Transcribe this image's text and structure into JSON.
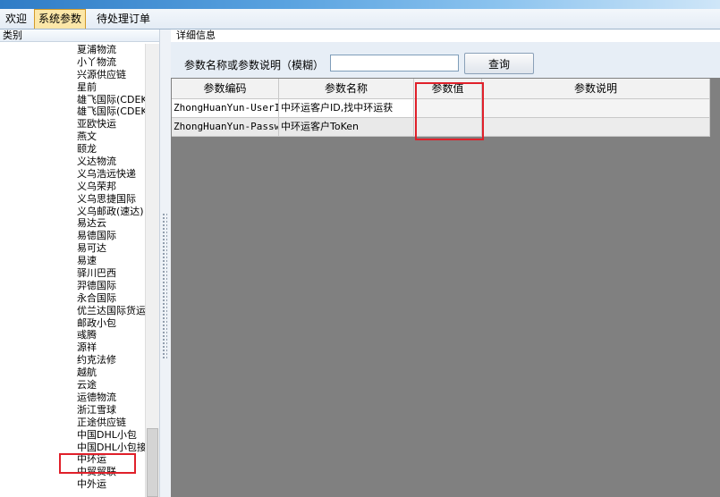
{
  "tabs": [
    {
      "label": "欢迎"
    },
    {
      "label": "系统参数"
    },
    {
      "label": "待处理订单"
    }
  ],
  "left_panel": {
    "header": "类别",
    "items": [
      "夏浦物流",
      "小丫物流",
      "兴源供应链",
      "星前",
      "雄飞国际(CDEK)",
      "雄飞国际(CDEK)",
      "亚欧快运",
      "燕文",
      "颐龙",
      "义达物流",
      "义乌浩远快递",
      "义乌荣邦",
      "义乌思捷国际",
      "义乌邮政(速达)",
      "易达云",
      "易德国际",
      "易可达",
      "易速",
      "驿川巴西",
      "羿德国际",
      "永合国际",
      "优兰达国际货运",
      "邮政小包",
      "彧腾",
      "源祥",
      "约克法修",
      "越航",
      "云途",
      "运德物流",
      "浙江雪球",
      "正途供应链",
      "中国DHL小包",
      "中国DHL小包接",
      "中环运",
      "中贸贸联",
      "中外运"
    ]
  },
  "right_panel": {
    "header": "详细信息",
    "search": {
      "label": "参数名称或参数说明（模糊）",
      "value": "",
      "button": "查询"
    },
    "grid": {
      "columns": [
        "参数编码",
        "参数名称",
        "参数值",
        "参数说明"
      ],
      "rows": [
        [
          "ZhongHuanYun-UserId",
          "中环运客户ID,找中环运获",
          "",
          ""
        ],
        [
          "ZhongHuanYun-Passwo",
          "中环运客户ToKen",
          "",
          ""
        ]
      ]
    }
  },
  "colors": {
    "highlight": "#e0202a",
    "active_tab": "#fce7a8",
    "grid_background": "#808080"
  }
}
